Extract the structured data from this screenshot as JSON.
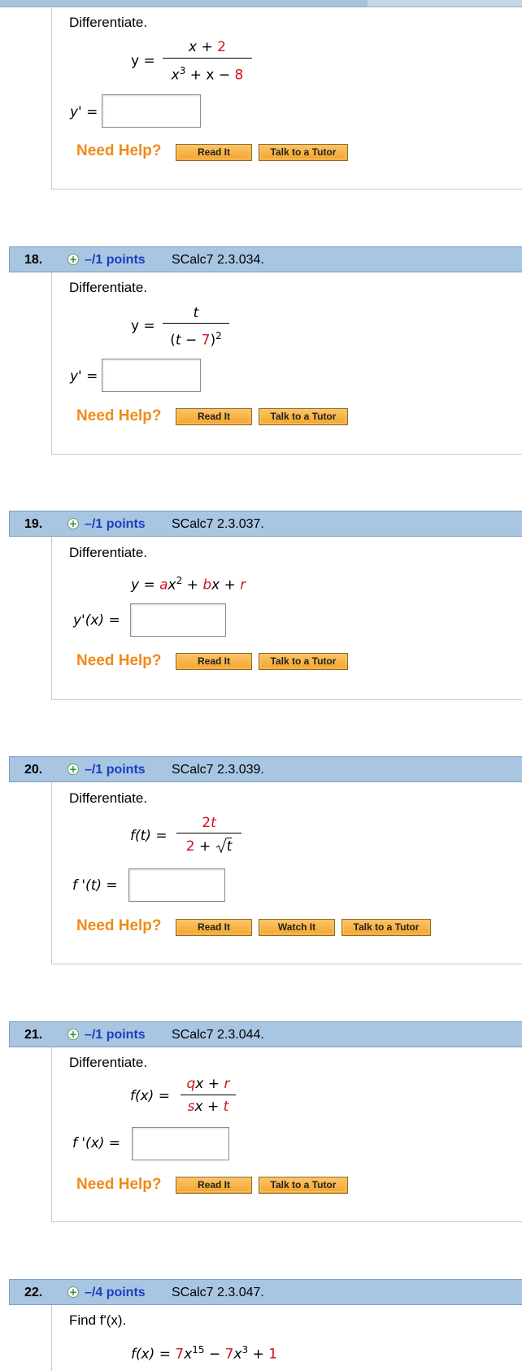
{
  "common": {
    "differentiate": "Differentiate.",
    "need_help": "Need Help?",
    "read_it": "Read It",
    "talk_to_tutor": "Talk to a Tutor",
    "watch_it": "Watch It",
    "plus": "+"
  },
  "q17": {
    "lhs": "y =",
    "num": [
      "x + ",
      "2"
    ],
    "den": [
      "x",
      "3",
      " + x − ",
      "8"
    ],
    "answer_label": "y' ="
  },
  "q18": {
    "number": "18.",
    "points": "–/1 points",
    "code": "SCalc7 2.3.034.",
    "lhs": "y =",
    "num": "t",
    "den": [
      "(",
      "t",
      " − ",
      "7",
      ")",
      "2"
    ],
    "answer_label": "y' ="
  },
  "q19": {
    "number": "19.",
    "points": "–/1 points",
    "code": "SCalc7 2.3.037.",
    "eq": [
      "y = ",
      "a",
      "x",
      "2",
      " + ",
      "b",
      "x + ",
      "r"
    ],
    "answer_label": "y'(x) ="
  },
  "q20": {
    "number": "20.",
    "points": "–/1 points",
    "code": "SCalc7 2.3.039.",
    "lhs": "f(t) =",
    "num": [
      "2",
      "t"
    ],
    "den": [
      "2",
      " + ",
      "t"
    ],
    "answer_label": "f '(t) ="
  },
  "q21": {
    "number": "21.",
    "points": "–/1 points",
    "code": "SCalc7 2.3.044.",
    "lhs": "f(x) =",
    "num": [
      "q",
      "x + ",
      "r"
    ],
    "den": [
      "s",
      "x + ",
      "t"
    ],
    "answer_label": "f '(x) ="
  },
  "q22": {
    "number": "22.",
    "points": "–/4 points",
    "code": "SCalc7 2.3.047.",
    "prompt": "Find  f'(x).",
    "eq": [
      "f(x) = ",
      "7",
      "x",
      "15",
      " − ",
      "7",
      "x",
      "3",
      " + ",
      "1"
    ]
  }
}
